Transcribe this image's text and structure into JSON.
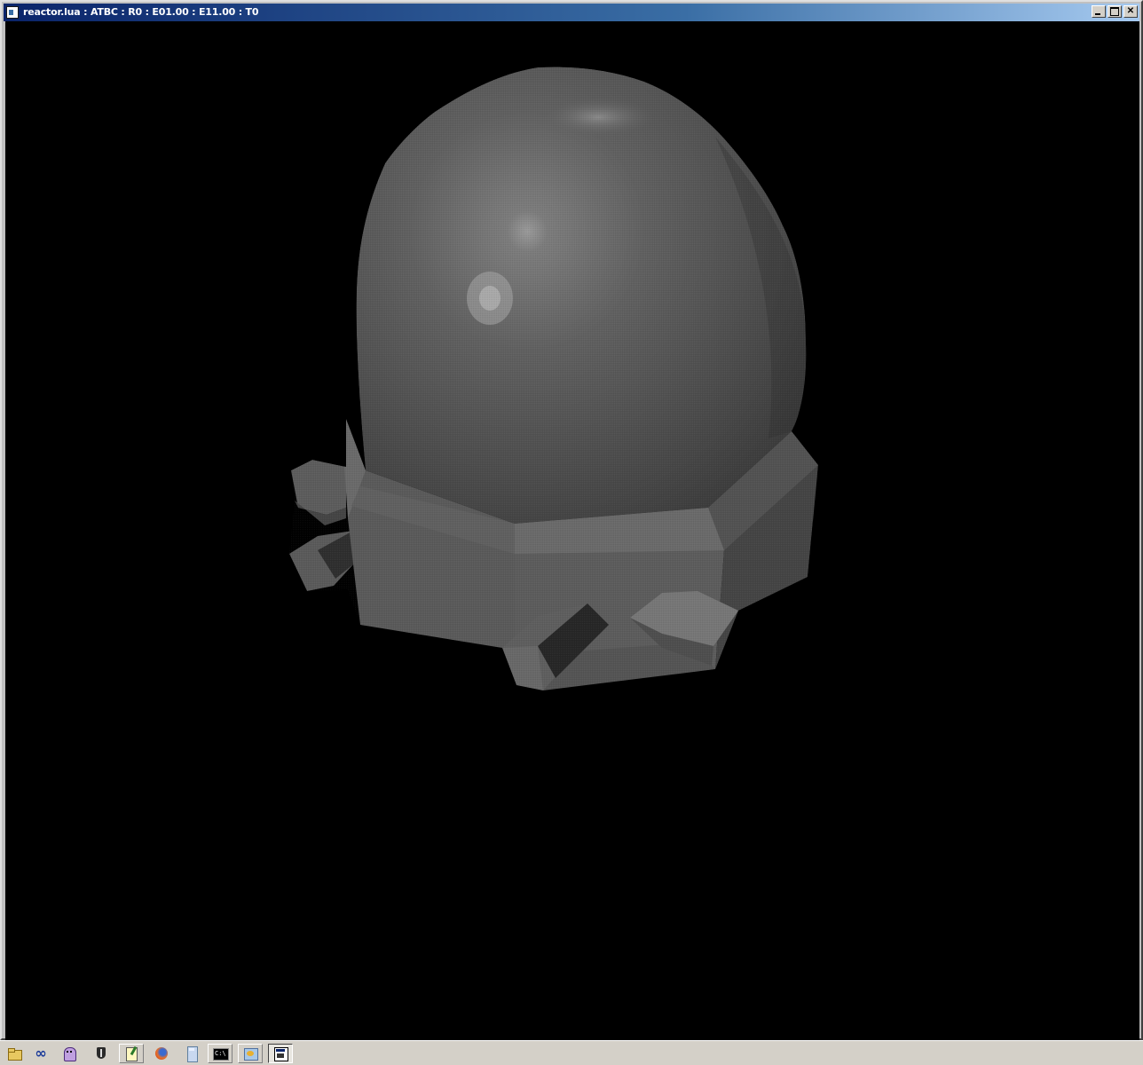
{
  "window": {
    "title": "reactor.lua : ATBC : R0 : E01.00 : E11.00 : T0",
    "buttons": {
      "minimize": "minimize-button",
      "maximize": "maximize-button",
      "close": "close-button"
    }
  },
  "viewport": {
    "background": "#000000",
    "object_color": "#5a5a5a",
    "object_name": "reactor"
  },
  "taskbar": {
    "items": [
      {
        "name": "file-explorer-icon"
      },
      {
        "name": "infinity-app-icon"
      },
      {
        "name": "ghost-app-icon"
      },
      {
        "name": "shield-app-icon"
      },
      {
        "name": "notepad-icon"
      },
      {
        "name": "firefox-icon"
      },
      {
        "name": "calculator-icon"
      },
      {
        "name": "command-prompt-icon"
      },
      {
        "name": "control-panel-icon"
      },
      {
        "name": "active-window-icon"
      }
    ]
  }
}
